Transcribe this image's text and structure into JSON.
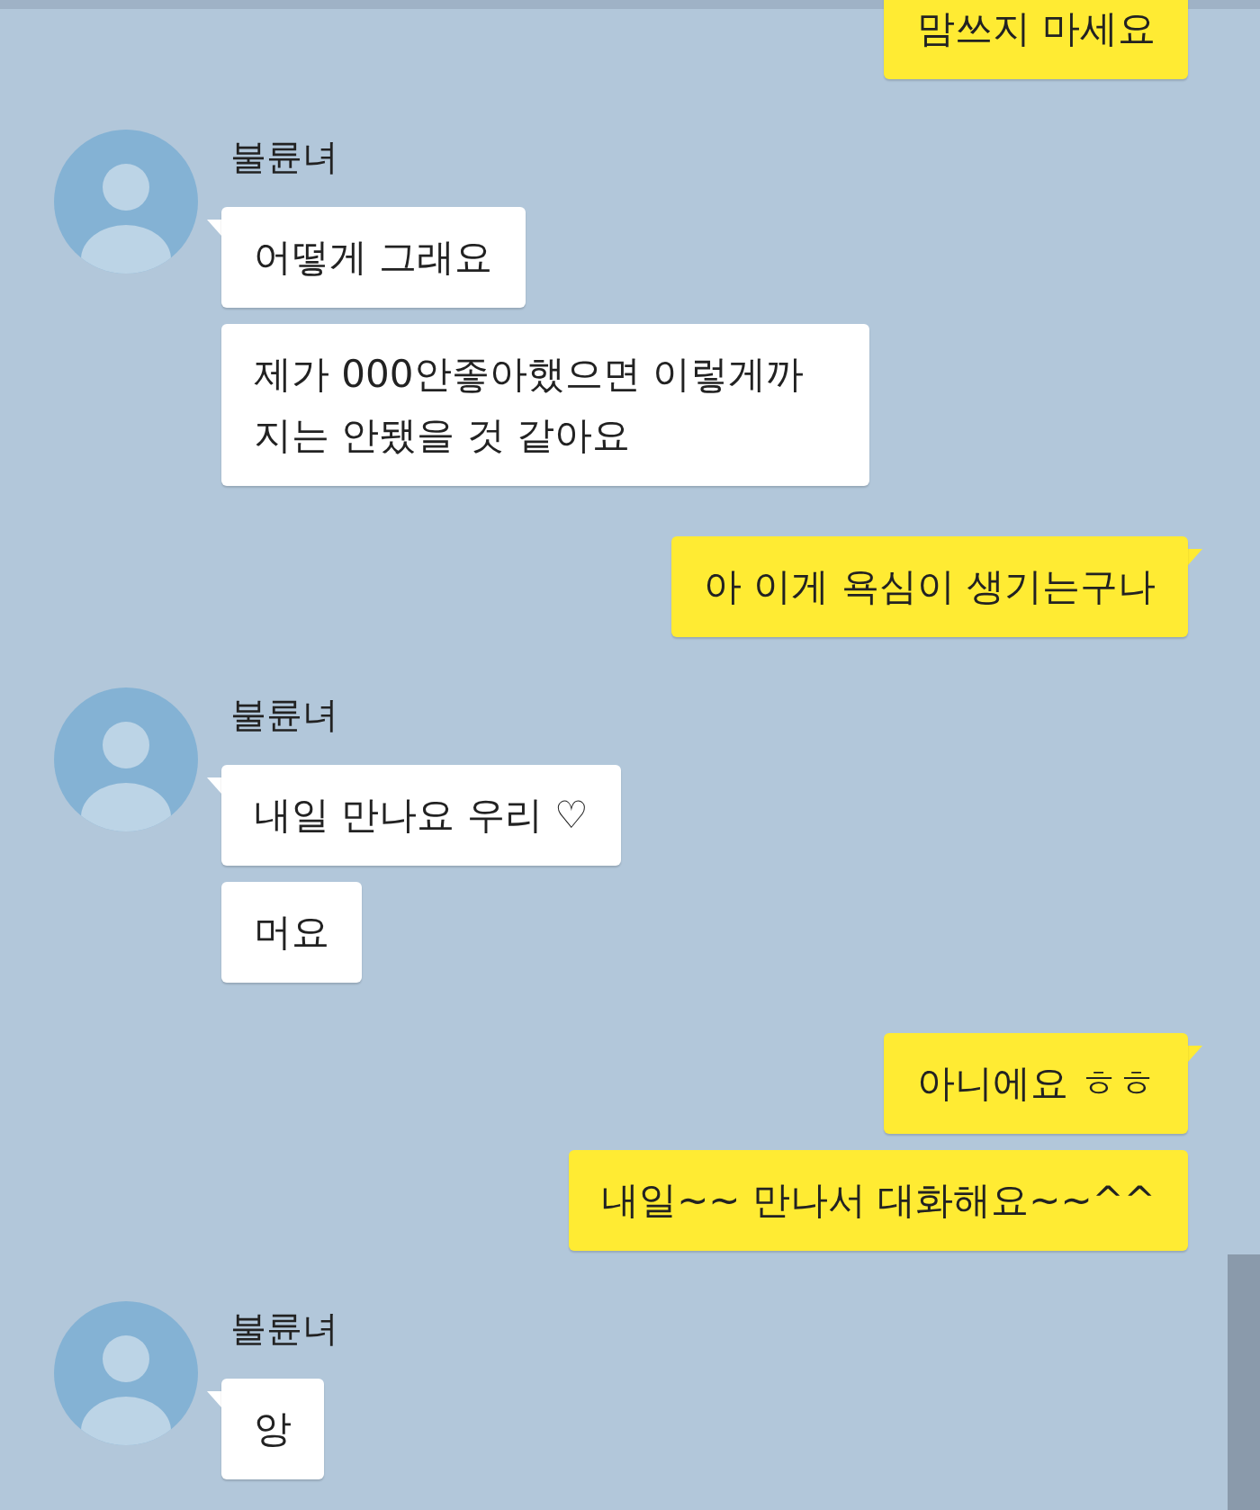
{
  "messages": [
    {
      "kind": "sent",
      "bubbles": [
        "맘쓰지 마세요"
      ],
      "tail": false
    },
    {
      "kind": "received",
      "sender": "불륜녀",
      "bubbles": [
        "어떻게 그래요",
        "제가 000안좋아했으면 이렇게까지는 안됐을 것 같아요"
      ],
      "tail": true
    },
    {
      "kind": "sent",
      "bubbles": [
        "아 이게 욕심이 생기는구나"
      ],
      "tail": true
    },
    {
      "kind": "received",
      "sender": "불륜녀",
      "bubbles": [
        "내일 만나요 우리 ♡",
        "머요"
      ],
      "tail": true
    },
    {
      "kind": "sent",
      "bubbles": [
        "아니에요 ㅎㅎ",
        "내일~~ 만나서 대화해요~~^^"
      ],
      "tail": true
    },
    {
      "kind": "received",
      "sender": "불륜녀",
      "bubbles": [
        "앙"
      ],
      "tail": true
    }
  ]
}
